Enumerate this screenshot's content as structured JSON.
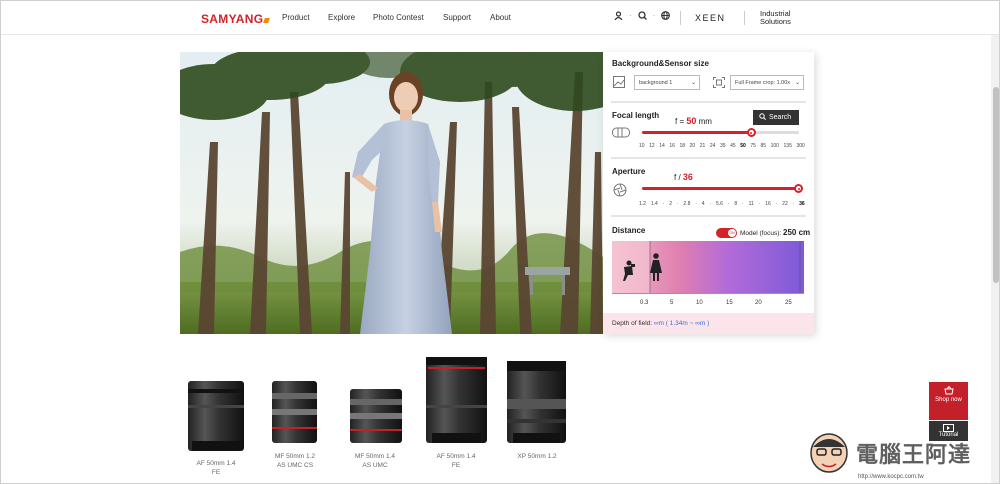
{
  "header": {
    "logo": "SAMYANG",
    "nav": [
      "Product",
      "Explore",
      "Photo Contest",
      "Support",
      "About"
    ],
    "xeen": "XEEN",
    "industrial": [
      "Industrial",
      "Solutions"
    ]
  },
  "panel": {
    "bg_title": "Background&Sensor size",
    "bg_select": "background 1",
    "sensor_select": "Full Frame crop: 1.00x",
    "focal_title": "Focal length",
    "focal_prefix": "f =",
    "focal_value": "50",
    "focal_unit": "mm",
    "search_label": "Search",
    "focal_level_pct": 70,
    "focal_ticks": [
      "10",
      "12",
      "14",
      "16",
      "18",
      "20",
      "21",
      "24",
      "35",
      "45",
      "50",
      "75",
      "85",
      "100",
      "135",
      "300"
    ],
    "focal_active": "50",
    "aperture_title": "Aperture",
    "aperture_prefix": "f /",
    "aperture_value": "36",
    "aperture_level_pct": 100,
    "aperture_ticks": [
      "1.2",
      "1.4",
      "·",
      "2",
      "·",
      "2.8",
      "·",
      "4",
      "·",
      "5.6",
      "·",
      "8",
      "·",
      "11",
      "·",
      "16",
      "·",
      "22",
      "·",
      "36"
    ],
    "distance_title": "Distance",
    "toggle_label": "ON",
    "distance_label": "Model (focus):",
    "distance_value": "250 cm",
    "distance_ticks": [
      "0.3",
      "5",
      "10",
      "15",
      "20",
      "25"
    ],
    "dof_label": "Depth of field:",
    "dof_value": "∞m  ( 1.34m ~ ∞m )"
  },
  "lenses": [
    {
      "name": "AF 50mm 1.4\nFE"
    },
    {
      "name": "MF 50mm 1.2\nAS UMC CS"
    },
    {
      "name": "MF 50mm 1.4\nAS UMC"
    },
    {
      "name": "AF 50mm 1.4\nFE"
    },
    {
      "name": "XP 50mm 1.2"
    }
  ],
  "floating": {
    "shop": "Shop now",
    "tutorial": "Tutorial"
  },
  "watermark": {
    "text": "電腦王阿達",
    "url": "http://www.kocpc.com.tw"
  }
}
